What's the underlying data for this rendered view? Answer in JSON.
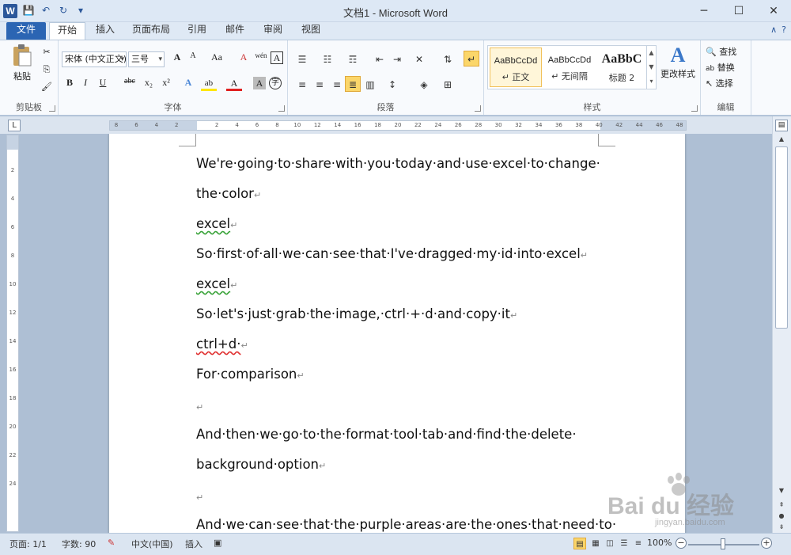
{
  "window": {
    "app_letter": "W",
    "title": "文档1 - Microsoft Word",
    "controls": {
      "minimize": "─",
      "maximize": "☐",
      "close": "✕"
    }
  },
  "qat": {
    "save": "💾",
    "undo": "↶",
    "redo": "↻",
    "customize": "▾"
  },
  "tabs": [
    "文件",
    "开始",
    "插入",
    "页面布局",
    "引用",
    "邮件",
    "审阅",
    "视图"
  ],
  "help": {
    "collapse": "∧",
    "help": "?"
  },
  "ribbon": {
    "clipboard": {
      "label": "剪贴板",
      "paste": "粘贴",
      "cut": "✂",
      "copy": "⎘",
      "format_painter": "🖌"
    },
    "font": {
      "label": "字体",
      "name": "宋体 (中文正文)",
      "size": "三号",
      "grow": "A",
      "shrink": "A",
      "change_case": "Aa",
      "clear": "A",
      "phonetic": "wén",
      "char_border": "A",
      "bold": "B",
      "italic": "I",
      "underline": "U",
      "strike": "abc",
      "subscript": "x₂",
      "superscript": "x²",
      "effects": "A",
      "highlight": "ab",
      "color": "A",
      "shading": "A",
      "enclose": "字"
    },
    "paragraph": {
      "label": "段落"
    },
    "styles": {
      "label": "样式",
      "items": [
        {
          "sample": "AaBbCcDd",
          "name": "↵ 正文"
        },
        {
          "sample": "AaBbCcDd",
          "name": "↵ 无间隔"
        },
        {
          "sample": "AaBbC",
          "name": "标题 2"
        }
      ],
      "change_styles": "更改样式"
    },
    "editing": {
      "label": "编辑",
      "find": "查找",
      "replace": "替换",
      "select": "选择"
    }
  },
  "ruler_ticks": [
    "8",
    "6",
    "4",
    "2",
    "",
    "2",
    "4",
    "6",
    "8",
    "10",
    "12",
    "14",
    "16",
    "18",
    "20",
    "22",
    "24",
    "26",
    "28",
    "30",
    "32",
    "34",
    "36",
    "38",
    "40",
    "42",
    "44",
    "46",
    "48"
  ],
  "vruler_ticks": [
    "2",
    "4",
    "6",
    "8",
    "10",
    "12",
    "14",
    "16",
    "18",
    "20",
    "22",
    "24"
  ],
  "document": {
    "paragraphs": [
      {
        "text": "We're·going·to·share·with·you·today·and·use·excel·to·change·",
        "justify": true
      },
      {
        "text": "the·color",
        "mark": "↵"
      },
      {
        "text": "excel",
        "mark": "↵",
        "squiggle": "green"
      },
      {
        "text": "So·first·of·all·we·can·see·that·I've·dragged·my·id·into·excel",
        "mark": "↵"
      },
      {
        "text": "excel",
        "mark": "↵",
        "squiggle": "green"
      },
      {
        "text": "So·let's·just·grab·the·image,·ctrl·+·d·and·copy·it",
        "mark": "↵"
      },
      {
        "text": "ctrl+d·",
        "mark": "↵",
        "squiggle": "red"
      },
      {
        "text": "For·comparison",
        "mark": "↵"
      },
      {
        "text": "",
        "mark": "↵"
      },
      {
        "text": "And·then·we·go·to·the·format·tool·tab·and·find·the·delete·",
        "justify": true
      },
      {
        "text": "background·option",
        "mark": "↵"
      },
      {
        "text": "",
        "mark": "↵"
      },
      {
        "text": "And·we·can·see·that·the·purple·areas·are·the·ones·that·need·to·",
        "justify": true
      }
    ]
  },
  "status": {
    "page": "页面: 1/1",
    "words": "字数: 90",
    "language": "中文(中国)",
    "insert": "插入",
    "zoom": "100%",
    "zoom_out": "−",
    "zoom_in": "+"
  },
  "watermark": {
    "main": "Bai du 经验",
    "sub": "jingyan.baidu.com"
  },
  "colors": {
    "file_tab": "#2b65b3",
    "highlight": "#fbd66a",
    "page_bg": "#aebfd4"
  }
}
